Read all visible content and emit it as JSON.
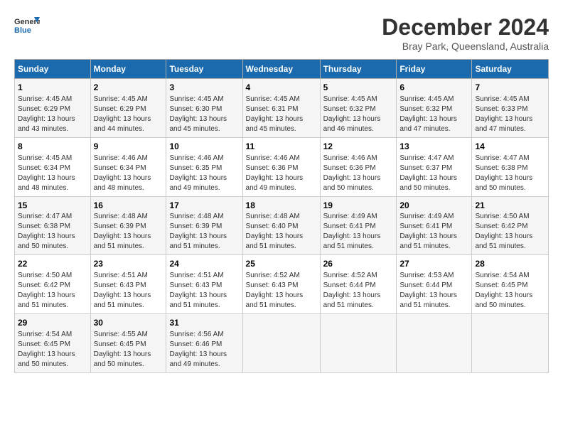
{
  "header": {
    "logo_line1": "General",
    "logo_line2": "Blue",
    "month": "December 2024",
    "location": "Bray Park, Queensland, Australia"
  },
  "columns": [
    "Sunday",
    "Monday",
    "Tuesday",
    "Wednesday",
    "Thursday",
    "Friday",
    "Saturday"
  ],
  "weeks": [
    [
      {
        "day": "1",
        "lines": [
          "Sunrise: 4:45 AM",
          "Sunset: 6:29 PM",
          "Daylight: 13 hours",
          "and 43 minutes."
        ]
      },
      {
        "day": "2",
        "lines": [
          "Sunrise: 4:45 AM",
          "Sunset: 6:29 PM",
          "Daylight: 13 hours",
          "and 44 minutes."
        ]
      },
      {
        "day": "3",
        "lines": [
          "Sunrise: 4:45 AM",
          "Sunset: 6:30 PM",
          "Daylight: 13 hours",
          "and 45 minutes."
        ]
      },
      {
        "day": "4",
        "lines": [
          "Sunrise: 4:45 AM",
          "Sunset: 6:31 PM",
          "Daylight: 13 hours",
          "and 45 minutes."
        ]
      },
      {
        "day": "5",
        "lines": [
          "Sunrise: 4:45 AM",
          "Sunset: 6:32 PM",
          "Daylight: 13 hours",
          "and 46 minutes."
        ]
      },
      {
        "day": "6",
        "lines": [
          "Sunrise: 4:45 AM",
          "Sunset: 6:32 PM",
          "Daylight: 13 hours",
          "and 47 minutes."
        ]
      },
      {
        "day": "7",
        "lines": [
          "Sunrise: 4:45 AM",
          "Sunset: 6:33 PM",
          "Daylight: 13 hours",
          "and 47 minutes."
        ]
      }
    ],
    [
      {
        "day": "8",
        "lines": [
          "Sunrise: 4:45 AM",
          "Sunset: 6:34 PM",
          "Daylight: 13 hours",
          "and 48 minutes."
        ]
      },
      {
        "day": "9",
        "lines": [
          "Sunrise: 4:46 AM",
          "Sunset: 6:34 PM",
          "Daylight: 13 hours",
          "and 48 minutes."
        ]
      },
      {
        "day": "10",
        "lines": [
          "Sunrise: 4:46 AM",
          "Sunset: 6:35 PM",
          "Daylight: 13 hours",
          "and 49 minutes."
        ]
      },
      {
        "day": "11",
        "lines": [
          "Sunrise: 4:46 AM",
          "Sunset: 6:36 PM",
          "Daylight: 13 hours",
          "and 49 minutes."
        ]
      },
      {
        "day": "12",
        "lines": [
          "Sunrise: 4:46 AM",
          "Sunset: 6:36 PM",
          "Daylight: 13 hours",
          "and 50 minutes."
        ]
      },
      {
        "day": "13",
        "lines": [
          "Sunrise: 4:47 AM",
          "Sunset: 6:37 PM",
          "Daylight: 13 hours",
          "and 50 minutes."
        ]
      },
      {
        "day": "14",
        "lines": [
          "Sunrise: 4:47 AM",
          "Sunset: 6:38 PM",
          "Daylight: 13 hours",
          "and 50 minutes."
        ]
      }
    ],
    [
      {
        "day": "15",
        "lines": [
          "Sunrise: 4:47 AM",
          "Sunset: 6:38 PM",
          "Daylight: 13 hours",
          "and 50 minutes."
        ]
      },
      {
        "day": "16",
        "lines": [
          "Sunrise: 4:48 AM",
          "Sunset: 6:39 PM",
          "Daylight: 13 hours",
          "and 51 minutes."
        ]
      },
      {
        "day": "17",
        "lines": [
          "Sunrise: 4:48 AM",
          "Sunset: 6:39 PM",
          "Daylight: 13 hours",
          "and 51 minutes."
        ]
      },
      {
        "day": "18",
        "lines": [
          "Sunrise: 4:48 AM",
          "Sunset: 6:40 PM",
          "Daylight: 13 hours",
          "and 51 minutes."
        ]
      },
      {
        "day": "19",
        "lines": [
          "Sunrise: 4:49 AM",
          "Sunset: 6:41 PM",
          "Daylight: 13 hours",
          "and 51 minutes."
        ]
      },
      {
        "day": "20",
        "lines": [
          "Sunrise: 4:49 AM",
          "Sunset: 6:41 PM",
          "Daylight: 13 hours",
          "and 51 minutes."
        ]
      },
      {
        "day": "21",
        "lines": [
          "Sunrise: 4:50 AM",
          "Sunset: 6:42 PM",
          "Daylight: 13 hours",
          "and 51 minutes."
        ]
      }
    ],
    [
      {
        "day": "22",
        "lines": [
          "Sunrise: 4:50 AM",
          "Sunset: 6:42 PM",
          "Daylight: 13 hours",
          "and 51 minutes."
        ]
      },
      {
        "day": "23",
        "lines": [
          "Sunrise: 4:51 AM",
          "Sunset: 6:43 PM",
          "Daylight: 13 hours",
          "and 51 minutes."
        ]
      },
      {
        "day": "24",
        "lines": [
          "Sunrise: 4:51 AM",
          "Sunset: 6:43 PM",
          "Daylight: 13 hours",
          "and 51 minutes."
        ]
      },
      {
        "day": "25",
        "lines": [
          "Sunrise: 4:52 AM",
          "Sunset: 6:43 PM",
          "Daylight: 13 hours",
          "and 51 minutes."
        ]
      },
      {
        "day": "26",
        "lines": [
          "Sunrise: 4:52 AM",
          "Sunset: 6:44 PM",
          "Daylight: 13 hours",
          "and 51 minutes."
        ]
      },
      {
        "day": "27",
        "lines": [
          "Sunrise: 4:53 AM",
          "Sunset: 6:44 PM",
          "Daylight: 13 hours",
          "and 51 minutes."
        ]
      },
      {
        "day": "28",
        "lines": [
          "Sunrise: 4:54 AM",
          "Sunset: 6:45 PM",
          "Daylight: 13 hours",
          "and 50 minutes."
        ]
      }
    ],
    [
      {
        "day": "29",
        "lines": [
          "Sunrise: 4:54 AM",
          "Sunset: 6:45 PM",
          "Daylight: 13 hours",
          "and 50 minutes."
        ]
      },
      {
        "day": "30",
        "lines": [
          "Sunrise: 4:55 AM",
          "Sunset: 6:45 PM",
          "Daylight: 13 hours",
          "and 50 minutes."
        ]
      },
      {
        "day": "31",
        "lines": [
          "Sunrise: 4:56 AM",
          "Sunset: 6:46 PM",
          "Daylight: 13 hours",
          "and 49 minutes."
        ]
      },
      null,
      null,
      null,
      null
    ]
  ]
}
